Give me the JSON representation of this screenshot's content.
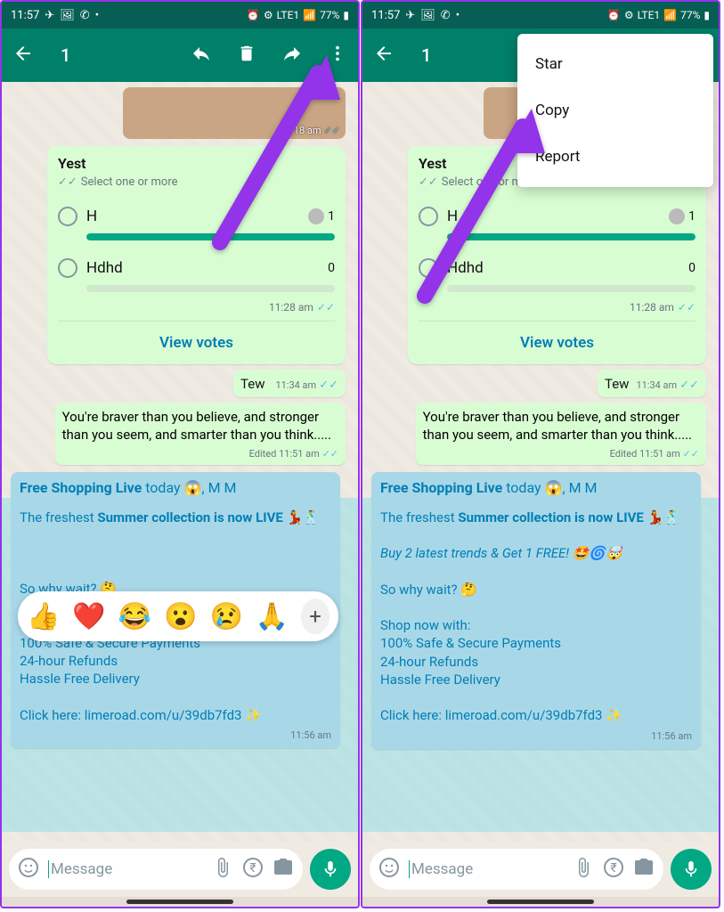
{
  "status": {
    "time": "11:57",
    "battery": "77%",
    "network": "LTE1"
  },
  "action": {
    "selected_count": "1"
  },
  "img_bubble": {
    "time": "11:18 am"
  },
  "poll": {
    "title": "Yest",
    "sub": "Select one or more",
    "opt1": {
      "label": "H",
      "count": "1"
    },
    "opt2": {
      "label": "Hdhd",
      "count": "0"
    },
    "time": "11:28 am",
    "view_votes": "View votes"
  },
  "msg_tew": {
    "text": "Tew",
    "time": "11:34 am"
  },
  "msg_quote": {
    "text": "You're braver than you believe, and stronger than you seem, and smarter than you think.....",
    "edited": "Edited",
    "time": "11:51 am"
  },
  "msg_promo": {
    "title_bold": "Free Shopping Live",
    "title_rest": " today 😱, M M",
    "line1_a": "The freshest ",
    "line1_b": "Summer collection is now LIVE 💃🕺",
    "line_deal": "Buy 2 latest trends & Get 1 FREE! 🤩🌀🤯",
    "line2": "So why wait? 🤔",
    "line3": "Shop now with:",
    "line4": "100% Safe & Secure Payments",
    "line5": "24-hour Refunds",
    "line6": "Hassle Free Delivery",
    "line7": "Click here: ",
    "link": "limeroad.com/u/39db7fd3",
    "sparkle": " ✨",
    "time": "11:56 am"
  },
  "input": {
    "placeholder": "Message"
  },
  "reactions": {
    "e1": "👍",
    "e2": "❤️",
    "e3": "😂",
    "e4": "😮",
    "e5": "😢",
    "e6": "🙏",
    "plus": "+"
  },
  "menu": {
    "star": "Star",
    "copy": "Copy",
    "report": "Report"
  }
}
